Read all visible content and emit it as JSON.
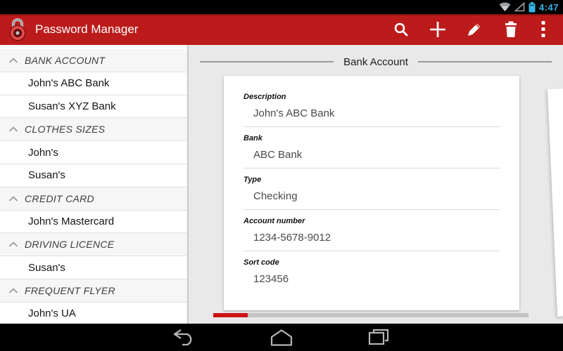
{
  "status_bar": {
    "time": "4:47",
    "icons": [
      "wifi-icon",
      "signal-icon",
      "battery-icon"
    ],
    "accent_blue": "#33b5e5"
  },
  "action_bar": {
    "title": "Password Manager",
    "background_red": "#bb1b1b",
    "actions": [
      "search",
      "add",
      "edit",
      "delete",
      "overflow"
    ]
  },
  "sidebar": {
    "groups": [
      {
        "label": "BANK ACCOUNT",
        "items": [
          "John's ABC Bank",
          "Susan's XYZ Bank"
        ]
      },
      {
        "label": "CLOTHES SIZES",
        "items": [
          "John's",
          "Susan's"
        ]
      },
      {
        "label": "CREDIT CARD",
        "items": [
          "John's Mastercard"
        ]
      },
      {
        "label": "DRIVING LICENCE",
        "items": [
          "Susan's"
        ]
      },
      {
        "label": "FREQUENT FLYER",
        "items": [
          "John's UA"
        ]
      }
    ]
  },
  "main": {
    "section_title": "Bank Account",
    "fields": [
      {
        "label": "Description",
        "value": "John's ABC Bank"
      },
      {
        "label": "Bank",
        "value": "ABC Bank"
      },
      {
        "label": "Type",
        "value": "Checking"
      },
      {
        "label": "Account number",
        "value": "1234-5678-9012"
      },
      {
        "label": "Sort code",
        "value": "123456"
      }
    ],
    "pager": {
      "progress_percent": 11,
      "fill_red": "#cc1414"
    }
  },
  "nav_bar": {
    "buttons": [
      "back",
      "home",
      "recents"
    ]
  }
}
